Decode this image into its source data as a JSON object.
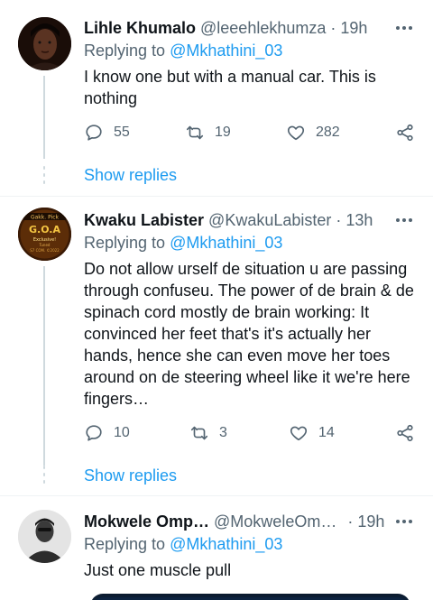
{
  "tweets": [
    {
      "name": "Lihle Khumalo",
      "handle": "@leeehlekhumza",
      "time": "19h",
      "replying_prefix": "Replying to",
      "replying_to": "@Mkhathini_03",
      "text": "I know one but with a manual car. This is nothing",
      "replies": "55",
      "retweets": "19",
      "likes": "282",
      "show_replies": "Show replies"
    },
    {
      "name": "Kwaku Labister",
      "handle": "@KwakuLabister",
      "time": "13h",
      "replying_prefix": "Replying to",
      "replying_to": "@Mkhathini_03",
      "text": "Do not allow urself de situation u are passing through confuseu. The power of de brain & de spinach cord mostly de brain working: It convinced her feet that's it's actually her hands, hence she can even move her toes around on de steering wheel like it we're here fingers…",
      "avatar_text": [
        "Gakk. Pick",
        "G.O.A",
        "Exclusive!",
        "Tuned",
        "S7 COM. ©2022"
      ],
      "replies": "10",
      "retweets": "3",
      "likes": "14",
      "show_replies": "Show replies"
    },
    {
      "name": "Mokwele Omp…",
      "handle": "@MokweleOm…",
      "time": "19h",
      "replying_prefix": "Replying to",
      "replying_to": "@Mkhathini_03",
      "text": "Just one muscle pull"
    }
  ],
  "icons": {
    "reply": "reply-icon",
    "retweet": "retweet-icon",
    "like": "heart-icon",
    "share": "share-icon",
    "more": "more-icon"
  },
  "colors": {
    "accent": "#1d9bf0",
    "secondary_text": "#536471",
    "primary_text": "#0f1419",
    "divider": "#eff3f4"
  }
}
